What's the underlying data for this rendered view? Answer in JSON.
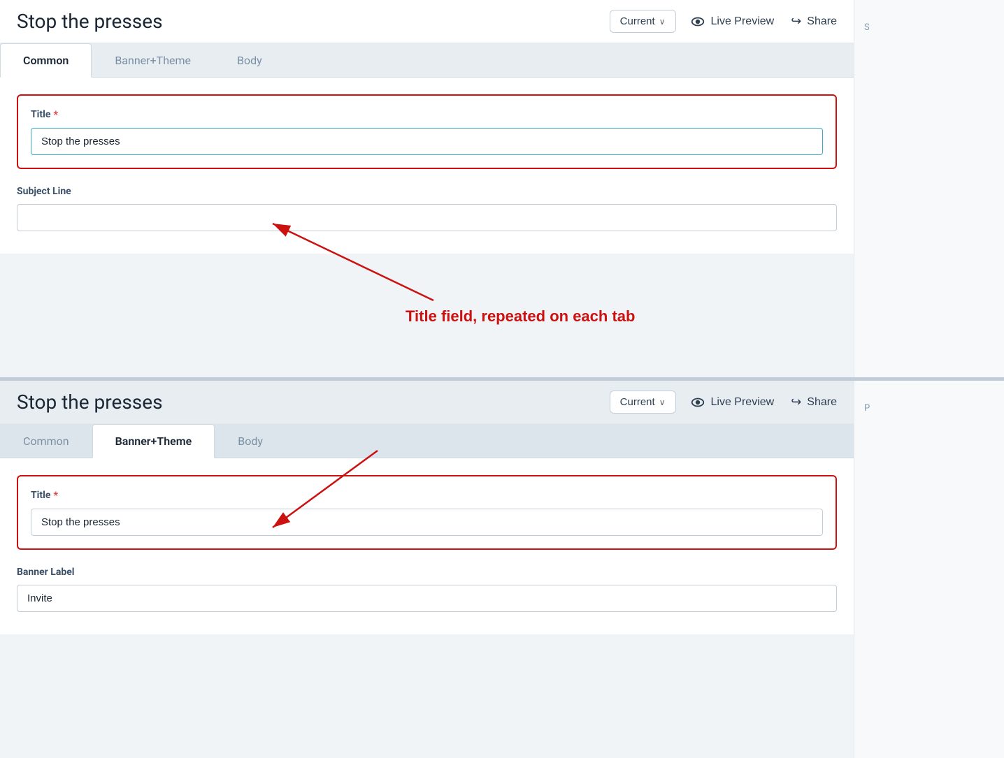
{
  "app": {
    "title": "Stop the presses",
    "version_label": "Current",
    "live_preview_label": "Live Preview",
    "share_label": "Share"
  },
  "section1": {
    "tabs": [
      {
        "id": "common",
        "label": "Common",
        "active": true
      },
      {
        "id": "banner-theme",
        "label": "Banner+Theme",
        "active": false
      },
      {
        "id": "body",
        "label": "Body",
        "active": false
      }
    ],
    "title_field": {
      "label": "Title",
      "required": true,
      "value": "Stop the presses"
    },
    "subject_field": {
      "label": "Subject Line",
      "required": false,
      "value": ""
    }
  },
  "section2": {
    "tabs": [
      {
        "id": "common",
        "label": "Common",
        "active": false
      },
      {
        "id": "banner-theme",
        "label": "Banner+Theme",
        "active": true
      },
      {
        "id": "body",
        "label": "Body",
        "active": false
      }
    ],
    "title_field": {
      "label": "Title",
      "required": true,
      "value": "Stop the presses"
    },
    "banner_label_field": {
      "label": "Banner Label",
      "required": false,
      "value": "Invite"
    }
  },
  "annotation": {
    "text": "Title field, repeated on each tab"
  },
  "icons": {
    "eye": "👁",
    "share": "↪",
    "chevron": "∨"
  }
}
